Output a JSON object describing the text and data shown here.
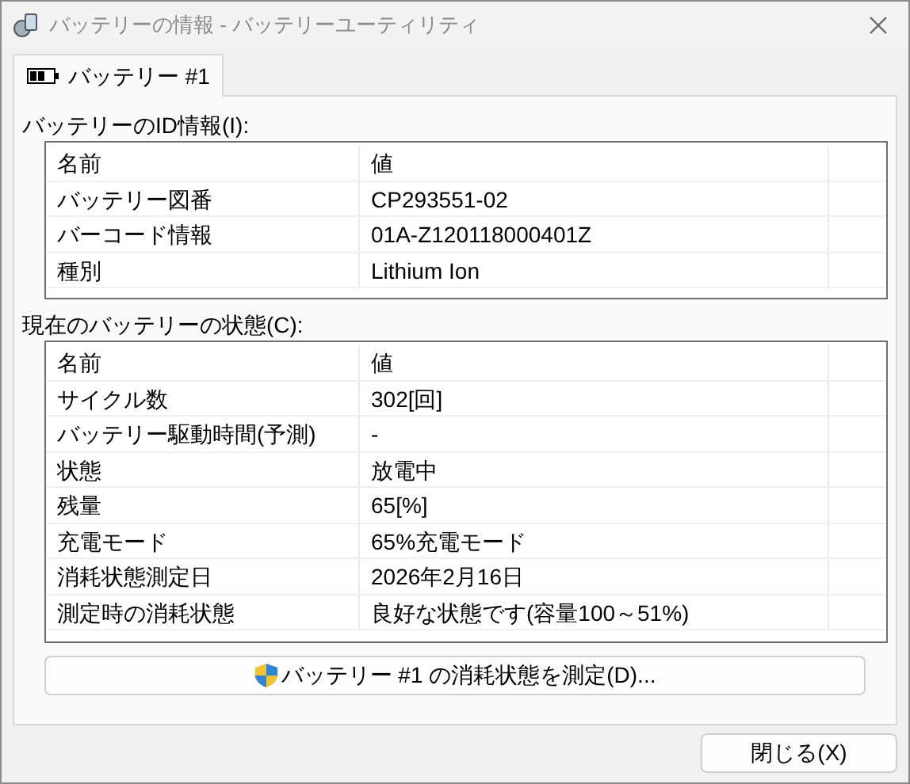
{
  "window": {
    "title": "バッテリーの情報 - バッテリーユーティリティ"
  },
  "tabs": [
    {
      "label": "バッテリー #1",
      "selected": true
    }
  ],
  "id_section": {
    "label": "バッテリーのID情報(I):",
    "columns": [
      "名前",
      "値"
    ],
    "rows": [
      {
        "name": "バッテリー図番",
        "value": "CP293551-02"
      },
      {
        "name": "バーコード情報",
        "value": "01A-Z120118000401Z"
      },
      {
        "name": "種別",
        "value": "Lithium Ion"
      }
    ]
  },
  "status_section": {
    "label": "現在のバッテリーの状態(C):",
    "columns": [
      "名前",
      "値"
    ],
    "rows": [
      {
        "name": "サイクル数",
        "value": "302[回]"
      },
      {
        "name": "バッテリー駆動時間(予測)",
        "value": "-"
      },
      {
        "name": "状態",
        "value": "放電中"
      },
      {
        "name": "残量",
        "value": "65[%]"
      },
      {
        "name": "充電モード",
        "value": "65%充電モード"
      },
      {
        "name": "消耗状態測定日",
        "value": "2026年2月16日"
      },
      {
        "name": "測定時の消耗状態",
        "value": "良好な状態です(容量100～51%)"
      }
    ]
  },
  "measure_button": "バッテリー #1 の消耗状態を測定(D)...",
  "buttons": [
    "閉じる(X)"
  ]
}
